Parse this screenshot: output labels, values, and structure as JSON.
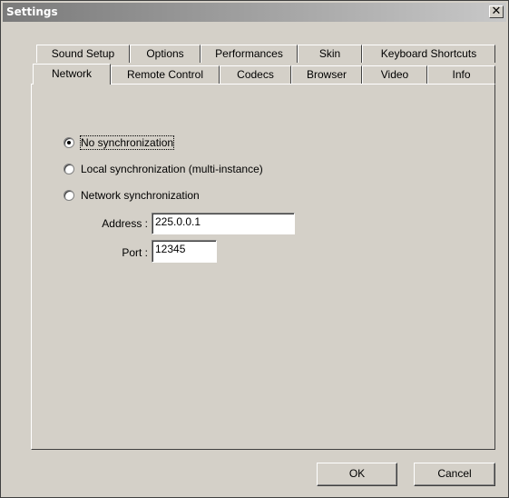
{
  "window": {
    "title": "Settings",
    "close_symbol": "✕"
  },
  "tabs": {
    "row_back": [
      "Sound Setup",
      "Options",
      "Performances",
      "Skin",
      "Keyboard Shortcuts"
    ],
    "row_front": [
      "Network",
      "Remote Control",
      "Codecs",
      "Browser",
      "Video",
      "Info"
    ],
    "active": "Network"
  },
  "network": {
    "options": [
      {
        "label": "No synchronization",
        "checked": true
      },
      {
        "label": "Local synchronization (multi-instance)",
        "checked": false
      },
      {
        "label": "Network synchronization",
        "checked": false
      }
    ],
    "address_label": "Address :",
    "address_value": "225.0.0.1",
    "port_label": "Port :",
    "port_value": "12345"
  },
  "buttons": {
    "ok": "OK",
    "cancel": "Cancel"
  }
}
